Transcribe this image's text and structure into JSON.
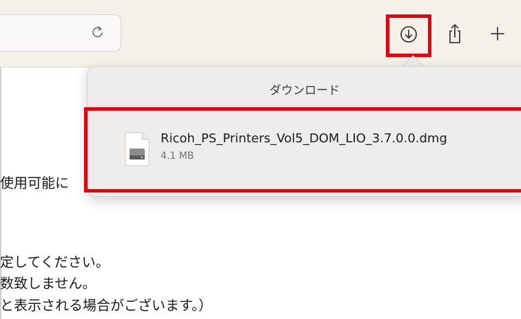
{
  "toolbar": {
    "reload_icon": "reload-icon",
    "download_icon": "download-icon",
    "share_icon": "share-icon",
    "new_tab_icon": "plus-icon"
  },
  "page": {
    "lines": [
      "使用可能に",
      "定してください。",
      "数致しません。",
      "と表示される場合がございます。）"
    ]
  },
  "downloads": {
    "title": "ダウンロード",
    "items": [
      {
        "file_name": "Ricoh_PS_Printers_Vol5_DOM_LIO_3.7.0.0.dmg",
        "size": "4.1 MB",
        "icon": "disk-image-icon"
      }
    ]
  },
  "colors": {
    "highlight": "#e8000b",
    "toolbar_bg": "#f5f1ea",
    "popover_bg": "#eeedec"
  }
}
